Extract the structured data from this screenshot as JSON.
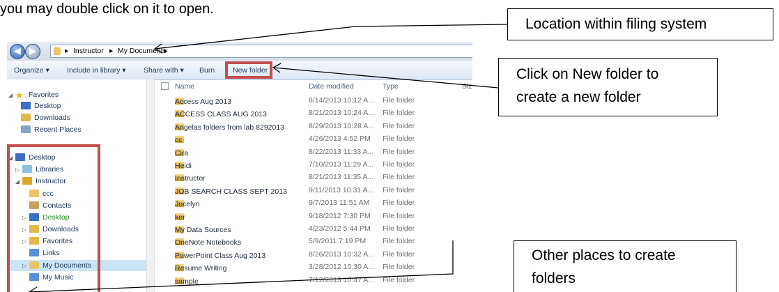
{
  "instruction_text": "you may double click on it to open.",
  "callouts": {
    "location": "Location within filing system",
    "new_folder_line1": "Click on New folder to",
    "new_folder_line2": "create a new folder",
    "other_line1": "Other places to create",
    "other_line2": "folders"
  },
  "address_bar": {
    "crumb1": "Instructor",
    "crumb2": "My Documents",
    "sep": "▸"
  },
  "toolbar": {
    "organize": "Organize ▾",
    "include": "Include in library ▾",
    "share": "Share with ▾",
    "burn": "Burn",
    "new_folder": "New folder"
  },
  "nav": {
    "favorites": "Favorites",
    "desktop_fav": "Desktop",
    "downloads_fav": "Downloads",
    "recent": "Recent Places",
    "desktop": "Desktop",
    "libraries": "Libraries",
    "instructor": "Instructor",
    "ccc": "ccc",
    "contacts": "Contacts",
    "desktop2": "Desktop",
    "downloads2": "Downloads",
    "favorites2": "Favorites",
    "links": "Links",
    "mydocs": "My Documents",
    "mymusic": "My Music"
  },
  "columns": {
    "name": "Name",
    "date": "Date modified",
    "type": "Type",
    "size": "Size"
  },
  "files": [
    {
      "name": "Access Aug 2013",
      "date": "8/14/2013 10:12 A...",
      "type": "File folder"
    },
    {
      "name": "ACCESS CLASS AUG 2013",
      "date": "8/21/2013 10:24 A...",
      "type": "File folder"
    },
    {
      "name": "Angelas folders from lab 8292013",
      "date": "8/29/2013 10:28 A...",
      "type": "File folder"
    },
    {
      "name": "cc",
      "date": "4/26/2013 4:52 PM",
      "type": "File folder"
    },
    {
      "name": "Cira",
      "date": "8/22/2013 11:33 A...",
      "type": "File folder"
    },
    {
      "name": "Heidi",
      "date": "7/10/2013 11:29 A...",
      "type": "File folder"
    },
    {
      "name": "Instructor",
      "date": "8/21/2013 11:35 A...",
      "type": "File folder"
    },
    {
      "name": "JOB SEARCH CLASS SEPT 2013",
      "date": "9/11/2013 10:31 A...",
      "type": "File folder"
    },
    {
      "name": "Jocelyn",
      "date": "9/7/2013 11:51 AM",
      "type": "File folder"
    },
    {
      "name": "ker",
      "date": "9/18/2012 7:30 PM",
      "type": "File folder"
    },
    {
      "name": "My Data Sources",
      "date": "4/23/2012 5:44 PM",
      "type": "File folder"
    },
    {
      "name": "OneNote Notebooks",
      "date": "5/9/2011 7:19 PM",
      "type": "File folder"
    },
    {
      "name": "PowerPoint Class Aug 2013",
      "date": "8/26/2013 10:32 A...",
      "type": "File folder"
    },
    {
      "name": "Resume Writing",
      "date": "3/28/2012 10:30 A...",
      "type": "File folder"
    },
    {
      "name": "sample",
      "date": "7/12/2013 10:47 A...",
      "type": "File folder"
    }
  ]
}
